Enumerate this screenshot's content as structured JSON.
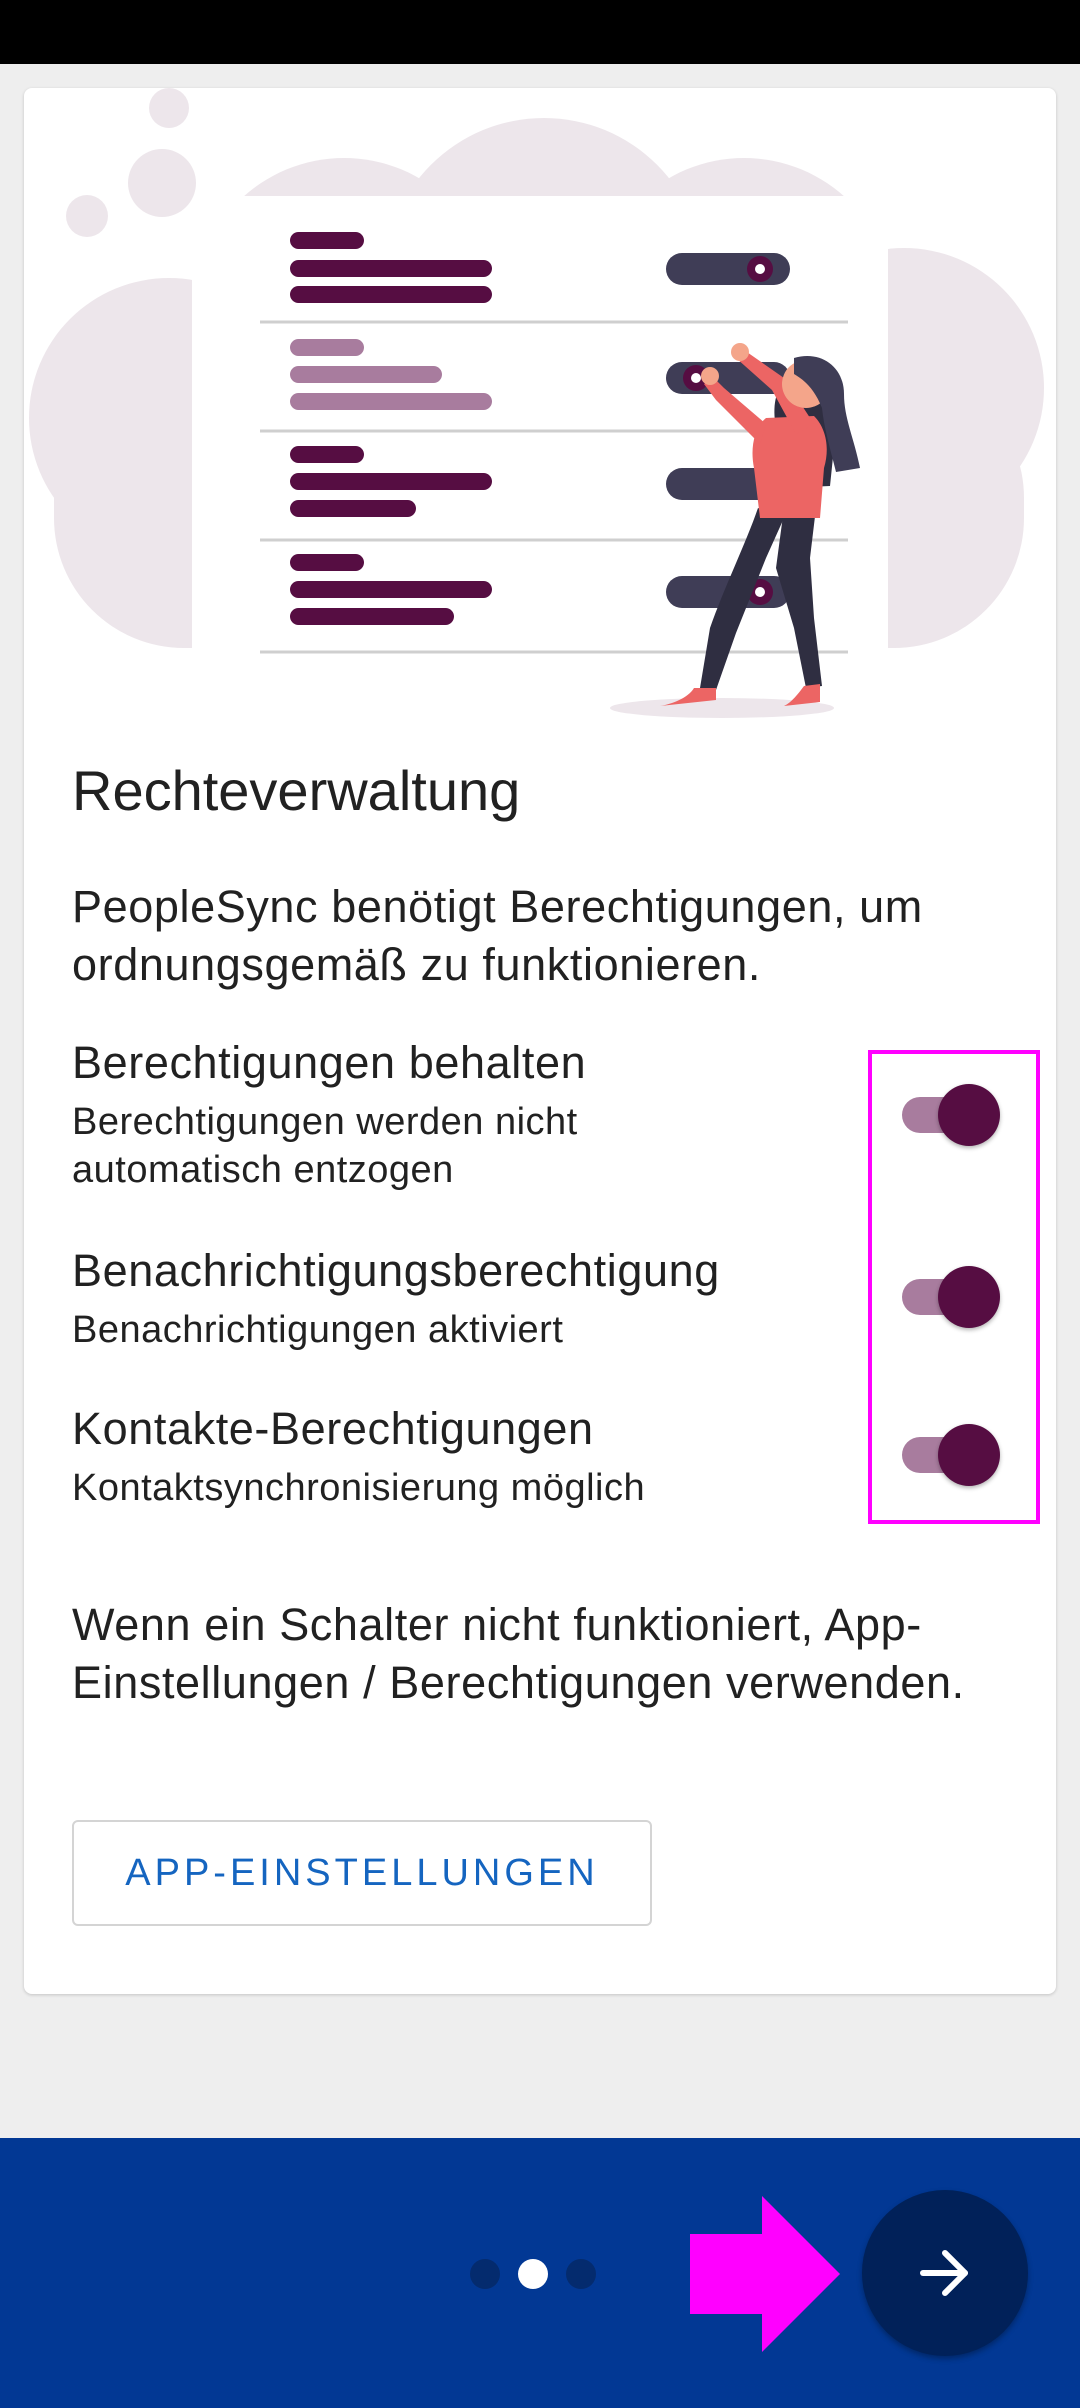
{
  "colors": {
    "accent": "#560d42",
    "switch_track": "#a87c9e",
    "link_blue": "#1565c0",
    "bottom_bar": "#023894",
    "fab": "#012159",
    "highlight": "#ff00ff"
  },
  "page": {
    "title": "Rechteverwaltung",
    "intro": "PeopleSync benötigt Berechtigungen, um ordnungsgemäß zu funktionieren."
  },
  "permissions": [
    {
      "title": "Berechtigungen behalten",
      "subtitle": "Berechtigungen werden nicht automatisch entzogen",
      "enabled": true
    },
    {
      "title": "Benachrichtigungsberechtigung",
      "subtitle": "Benachrichtigungen aktiviert",
      "enabled": true
    },
    {
      "title": "Kontakte-Berechtigungen",
      "subtitle": "Kontaktsynchronisierung möglich",
      "enabled": true
    }
  ],
  "hint": "Wenn ein Schalter nicht funktioniert, App-Einstellungen / Berechtigungen verwenden.",
  "settings_button": "APP-EINSTELLUNGEN",
  "pager": {
    "total": 3,
    "current": 2
  },
  "icons": {
    "illustration": "permissions-illustration",
    "next": "arrow-right-icon",
    "pointer": "magenta-arrow-icon"
  }
}
